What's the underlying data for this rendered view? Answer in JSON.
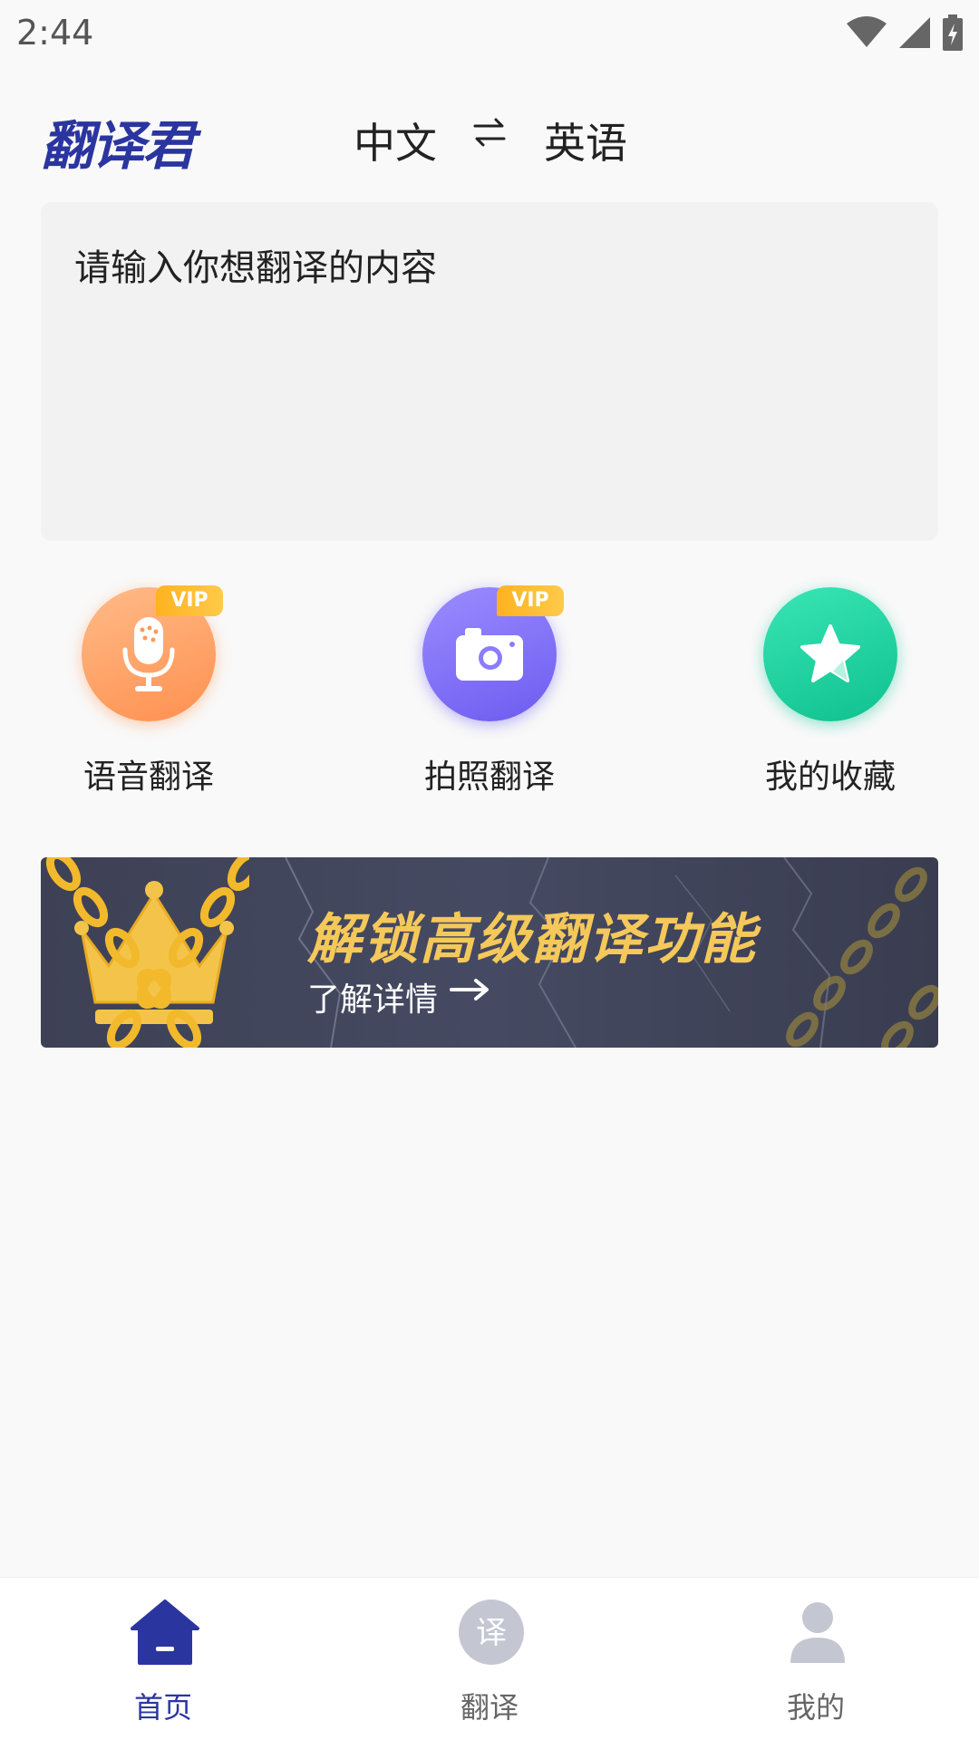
{
  "status_bar": {
    "time": "2:44"
  },
  "header": {
    "brand": "翻译君",
    "source_lang": "中文",
    "target_lang": "英语"
  },
  "input": {
    "placeholder": "请输入你想翻译的内容"
  },
  "features": [
    {
      "label": "语音翻译",
      "badge": "VIP",
      "icon": "microphone-icon"
    },
    {
      "label": "拍照翻译",
      "badge": "VIP",
      "icon": "camera-icon"
    },
    {
      "label": "我的收藏",
      "icon": "star-icon"
    }
  ],
  "banner": {
    "title": "解锁高级翻译功能",
    "link": "了解详情"
  },
  "bottom_nav": {
    "items": [
      {
        "label": "首页",
        "icon": "home-icon",
        "active": true
      },
      {
        "label": "翻译",
        "icon": "translate-icon",
        "icon_text": "译"
      },
      {
        "label": "我的",
        "icon": "user-icon"
      }
    ]
  },
  "colors": {
    "brand": "#2b35a0",
    "vip": "#ffb21f",
    "banner_title": "#f5c85a"
  }
}
